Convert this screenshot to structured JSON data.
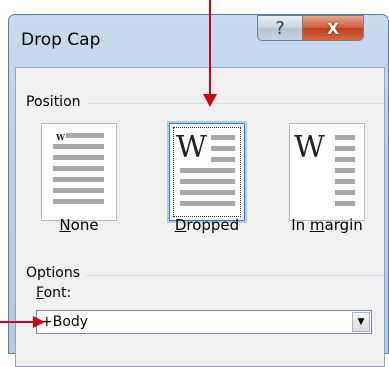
{
  "dialog": {
    "title": "Drop Cap",
    "help_glyph": "?",
    "close_glyph": "X"
  },
  "position": {
    "label": "Position",
    "options": [
      {
        "label_prefix": "",
        "label_mnemonic": "N",
        "label_rest": "one",
        "selected": false
      },
      {
        "label_prefix": "",
        "label_mnemonic": "D",
        "label_rest": "ropped",
        "selected": true
      },
      {
        "label_prefix": "In ",
        "label_mnemonic": "m",
        "label_rest": "argin",
        "selected": false
      }
    ],
    "tile_letter": "W"
  },
  "options": {
    "label": "Options",
    "font_label_mnemonic": "F",
    "font_label_rest": "ont:",
    "font_value": "+Body",
    "dropdown_glyph": "▼"
  },
  "colors": {
    "annotation_arrow": "#d0021b",
    "selection_border": "#3c7fb1"
  }
}
